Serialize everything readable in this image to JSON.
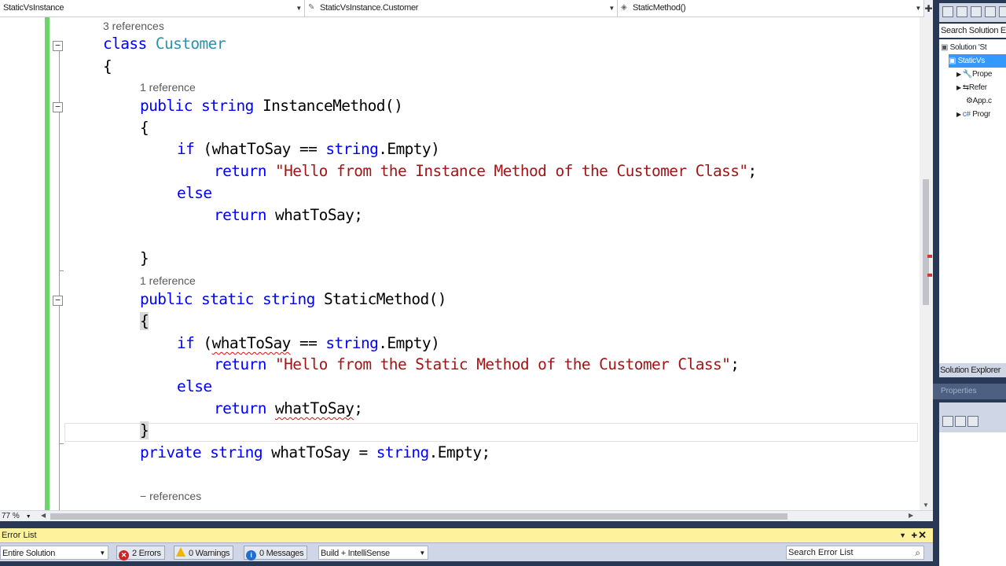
{
  "navbar": {
    "project_dropdown": "StaticVsInstance",
    "class_dropdown": "StaticVsInstance.Customer",
    "member_dropdown": "StaticMethod()",
    "split_icon": "plus-icon"
  },
  "editor": {
    "lens": {
      "class_refs": "3 references",
      "instance_refs": "1 reference",
      "static_refs": "1 reference",
      "field_refs": "− references"
    },
    "code": {
      "class_kw": "class",
      "class_name": "Customer",
      "open_brace": "{",
      "public": "public",
      "static": "static",
      "string": "string",
      "instance_method": "InstanceMethod()",
      "static_method": "StaticMethod()",
      "if_kw": "if",
      "open_paren": " (",
      "what_to_say": "whatToSay",
      "eq_op": " == ",
      "string_type": "string",
      "empty_paren": ".Empty)",
      "return_kw": "return",
      "instance_msg": "\"Hello from the Instance Method of the Customer Class\"",
      "static_msg": "\"Hello from the Static Method of the Customer Class\"",
      "semicolon": ";",
      "else_kw": "else",
      "close_brace": "}",
      "private": "private",
      "field_name": "whatToSay",
      "assign": " = ",
      "empty_end": ".Empty;",
      "space": " "
    }
  },
  "statusbar": {
    "zoom": "77 %"
  },
  "error_list": {
    "title": "Error List",
    "scope": "Entire Solution",
    "errors": "2 Errors",
    "warnings": "0 Warnings",
    "messages": "0 Messages",
    "build_filter": "Build + IntelliSense",
    "search_placeholder": "Search Error List"
  },
  "solution_explorer": {
    "search": "Search Solution E",
    "solution": "Solution 'St",
    "project": "StaticVs",
    "items": [
      "Prope",
      "Refer",
      "App.c",
      "Progr"
    ],
    "label": "Solution Explorer",
    "properties_title": "Properties"
  },
  "colors": {
    "keyword": "#0000ff",
    "type": "#2b91af",
    "string": "#a31515",
    "change_bar": "#6ad56a",
    "error_list_title_bg": "#fff29d",
    "frame": "#293955"
  }
}
